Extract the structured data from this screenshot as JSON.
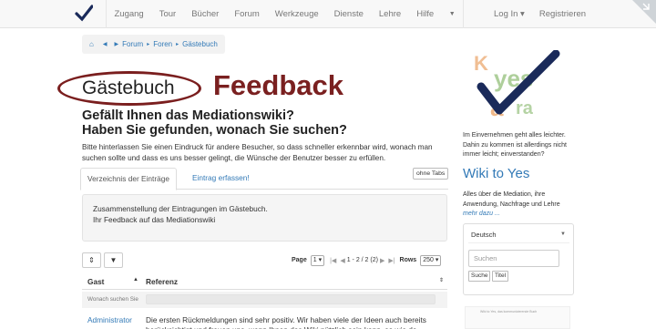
{
  "colors": {
    "accent": "#337ab7",
    "feedback": "#7a2020",
    "oval": "#7a1e1e",
    "brand": "#1a2a5a",
    "logo_orange": "#e58a3c",
    "logo_green": "#7ab05a"
  },
  "navbar": {
    "brand_icon": "checkmark-logo-icon",
    "items": [
      "Zugang",
      "Tour",
      "Bücher",
      "Forum",
      "Werkzeuge",
      "Dienste",
      "Lehre",
      "Hilfe"
    ],
    "more_icon": "caret-down-icon",
    "login": "Log In ▾",
    "register": "Registrieren"
  },
  "breadcrumb": {
    "home_icon": "home-icon",
    "items": [
      "Forum",
      "Foren",
      "Gästebuch"
    ]
  },
  "page": {
    "title": "Gästebuch",
    "annotation": "Feedback",
    "subtitle_line1": "Gefällt Ihnen das Mediationswiki?",
    "subtitle_line2": "Haben Sie gefunden, wonach Sie suchen?",
    "intro": "Bitte hinterlassen Sie einen Eindruck für andere Besucher, so dass schneller erkennbar wird, wonach man suchen sollte und dass es uns besser gelingt, die Wünsche der Benutzer besser zu erfüllen."
  },
  "tabs": {
    "list": "Verzeichnis der Einträge",
    "add": "Eintrag erfassen!",
    "no_tabs": "ohne Tabs"
  },
  "description": {
    "line1": "Zusammenstellung der Eintragungen im Gästebuch.",
    "line2": "Ihr Feedback auf das Mediationswiki"
  },
  "table": {
    "sort_icon": "sort-icon",
    "filter_icon": "filter-icon",
    "page_label": "Page",
    "page_value": "1",
    "range": "1 - 2 / 2 (2)",
    "rows_label": "Rows",
    "rows_value": "250",
    "col_gast": "Gast",
    "col_referenz": "Referenz",
    "filter_placeholder": "Wonach suchen Sie",
    "rows": [
      {
        "author": "Administrator",
        "text": "Die ersten Rückmeldungen sind sehr positiv. Wir haben viele der Ideen auch bereits berücksichtigt und freuen uns, wenn Ihnen das Wiki nützlich sein kann, so wie de"
      }
    ]
  },
  "sidebar": {
    "logo_text": "Klar yes",
    "text1": "Im Einvernehmen geht alles leichter. Dahin zu kommen ist allerdings nicht immer leicht; einverstanden?",
    "heading": "Wiki to Yes",
    "text2": "Alles über die Mediation, ihre Anwendung, Nachfrage und Lehre",
    "more": "mehr dazu ...",
    "language": "Deutsch",
    "search_placeholder": "Suchen",
    "search_button": "Suche",
    "title_button": "Titel",
    "book_caption": "Wiki to Yes, das kommunizierende Buch"
  }
}
